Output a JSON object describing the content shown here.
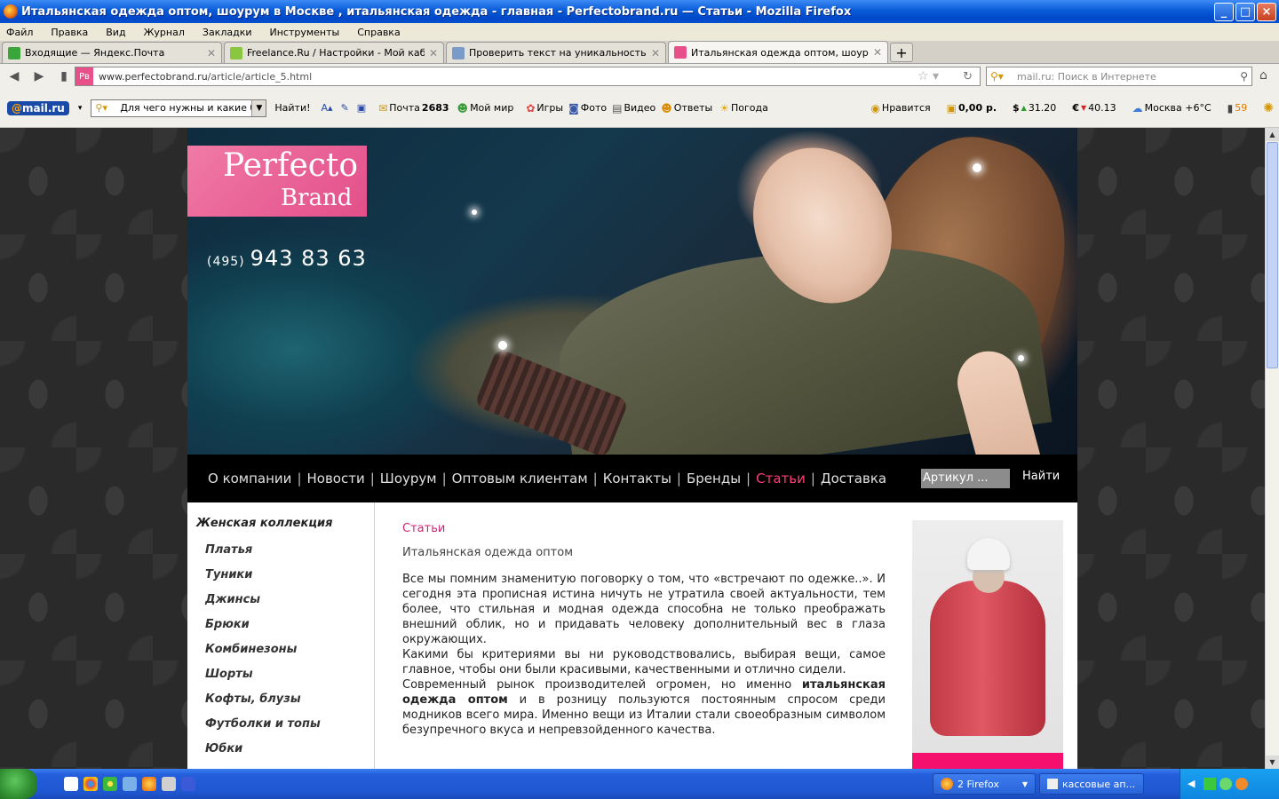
{
  "window": {
    "title": "Итальянская одежда оптом, шоурум в Москве , итальянская одежда - главная - Perfectobrand.ru — Статьи - Mozilla Firefox",
    "controls": [
      "_",
      "□",
      "×"
    ]
  },
  "menu": [
    "Файл",
    "Правка",
    "Вид",
    "Журнал",
    "Закладки",
    "Инструменты",
    "Справка"
  ],
  "tabs": [
    {
      "label": "Входящие — Яндекс.Почта",
      "icon_color": "#3aa53a"
    },
    {
      "label": "Freelance.Ru / Настройки - Мой кабинет",
      "icon_color": "#8ac640"
    },
    {
      "label": "Проверить текст на уникальность онл...",
      "icon_color": "#7a9ac8"
    },
    {
      "label": "Итальянская одежда оптом, шоурум в...",
      "icon_color": "#e8508a"
    }
  ],
  "address": {
    "favicon": "Pв",
    "host": "www.perfectobrand.ru",
    "path": "/article/article_5.html"
  },
  "search": {
    "placeholder": "mail.ru: Поиск в Интернете"
  },
  "mailbar": {
    "logo_at": "@",
    "logo_text": "mail.ru",
    "search_value": "Для чего нужны и какие бые",
    "find": "Найти!",
    "mail_label": "Почта",
    "mail_count": "2683",
    "items": [
      "Мой мир",
      "Игры",
      "Фото",
      "Видео",
      "Ответы",
      "Погода"
    ],
    "like": "Нравится",
    "balance": "0,00 р.",
    "usd": "31.20",
    "eur": "40.13",
    "weather": "Москва +6°C",
    "count": "59"
  },
  "site": {
    "logo_line1": "Perfecto",
    "logo_line2": "Brand",
    "phone_code": "(495)",
    "phone_number": "943 83 63",
    "nav": [
      "О компании",
      "Новости",
      "Шоурум",
      "Оптовым клиентам",
      "Контакты",
      "Бренды",
      "Статьи",
      "Доставка"
    ],
    "nav_active_index": 6,
    "article_placeholder": "Артикул    ...",
    "find_button": "Найти",
    "collection_title": "Женская коллекция",
    "categories": [
      "Платья",
      "Туники",
      "Джинсы",
      "Брюки",
      "Комбинезоны",
      "Шорты",
      "Кофты, блузы",
      "Футболки и топы",
      "Юбки"
    ],
    "breadcrumb": "Статьи",
    "article_title": "Итальянская одежда оптом",
    "p1": "Все мы помним знаменитую поговорку о том, что «встречают по одежке..». И сегодня эта прописная истина ничуть не утратила своей актуальности, тем более, что стильная и модная одежда способна не только преображать внешний облик, но и придавать человеку дополнительный вес в глаза окружающих.",
    "p2": "Какими бы критериями вы ни руководствовались, выбирая вещи, самое главное, чтобы они были красивыми, качественными и отлично сидели.",
    "p3_pre": "Современный рынок производителей огромен, но именно ",
    "p3_bold": "итальянская одежда оптом",
    "p3_post": " и в розницу пользуются постоянным спросом среди модников всего мира. Именно вещи из Италии стали своеобразным символом безупречного вкуса и непревзойденного качества."
  },
  "taskbar": {
    "firefox_task": "2 Firefox",
    "other_task": "кассовые ап..."
  }
}
